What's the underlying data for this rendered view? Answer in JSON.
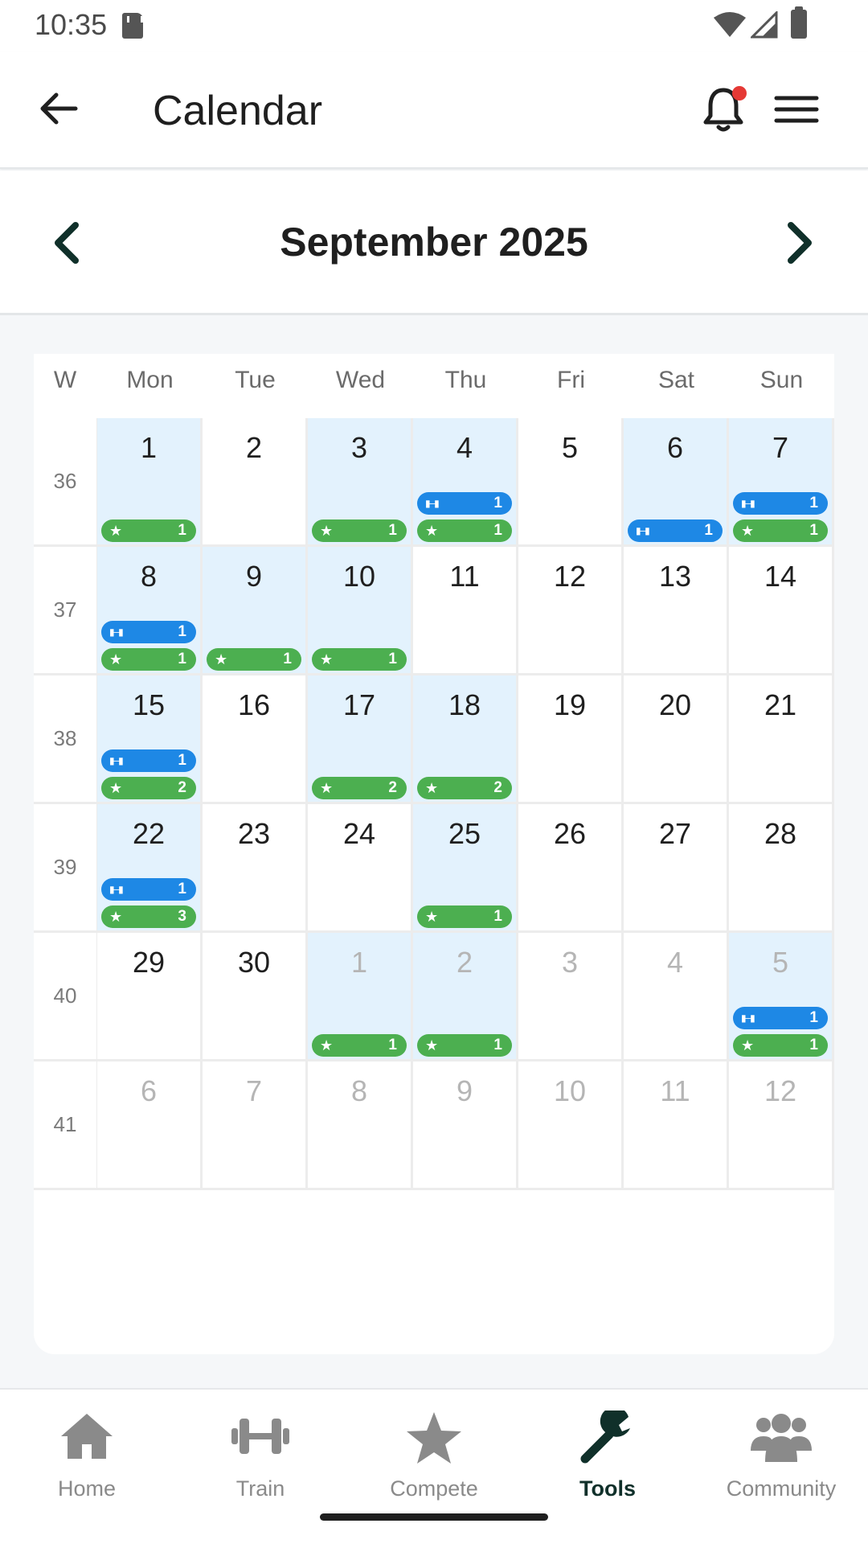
{
  "status_bar": {
    "time": "10:35"
  },
  "app_bar": {
    "title": "Calendar",
    "has_notification": true,
    "notification_dot_color": "#e53935"
  },
  "month_nav": {
    "title": "September 2025"
  },
  "weekdays": {
    "week_header": "W",
    "days": [
      "Mon",
      "Tue",
      "Wed",
      "Thu",
      "Fri",
      "Sat",
      "Sun"
    ]
  },
  "colors": {
    "train_badge": "#1e88e5",
    "compete_badge": "#4caf50",
    "active_day_bg": "#e3f2fd",
    "accent": "#10302a"
  },
  "weeks": [
    {
      "week": "36",
      "days": [
        {
          "day": "1",
          "train": null,
          "compete": "1",
          "other": false
        },
        {
          "day": "2",
          "train": null,
          "compete": null,
          "other": false
        },
        {
          "day": "3",
          "train": null,
          "compete": "1",
          "other": false
        },
        {
          "day": "4",
          "train": "1",
          "compete": "1",
          "other": false
        },
        {
          "day": "5",
          "train": null,
          "compete": null,
          "other": false
        },
        {
          "day": "6",
          "train": "1",
          "compete": null,
          "other": false
        },
        {
          "day": "7",
          "train": "1",
          "compete": "1",
          "other": false
        }
      ]
    },
    {
      "week": "37",
      "days": [
        {
          "day": "8",
          "train": "1",
          "compete": "1",
          "other": false
        },
        {
          "day": "9",
          "train": null,
          "compete": "1",
          "other": false
        },
        {
          "day": "10",
          "train": null,
          "compete": "1",
          "other": false
        },
        {
          "day": "11",
          "train": null,
          "compete": null,
          "other": false
        },
        {
          "day": "12",
          "train": null,
          "compete": null,
          "other": false
        },
        {
          "day": "13",
          "train": null,
          "compete": null,
          "other": false
        },
        {
          "day": "14",
          "train": null,
          "compete": null,
          "other": false
        }
      ]
    },
    {
      "week": "38",
      "days": [
        {
          "day": "15",
          "train": "1",
          "compete": "2",
          "other": false
        },
        {
          "day": "16",
          "train": null,
          "compete": null,
          "other": false
        },
        {
          "day": "17",
          "train": null,
          "compete": "2",
          "other": false
        },
        {
          "day": "18",
          "train": null,
          "compete": "2",
          "other": false
        },
        {
          "day": "19",
          "train": null,
          "compete": null,
          "other": false
        },
        {
          "day": "20",
          "train": null,
          "compete": null,
          "other": false
        },
        {
          "day": "21",
          "train": null,
          "compete": null,
          "other": false
        }
      ]
    },
    {
      "week": "39",
      "days": [
        {
          "day": "22",
          "train": "1",
          "compete": "3",
          "other": false
        },
        {
          "day": "23",
          "train": null,
          "compete": null,
          "other": false
        },
        {
          "day": "24",
          "train": null,
          "compete": null,
          "other": false
        },
        {
          "day": "25",
          "train": null,
          "compete": "1",
          "other": false
        },
        {
          "day": "26",
          "train": null,
          "compete": null,
          "other": false
        },
        {
          "day": "27",
          "train": null,
          "compete": null,
          "other": false
        },
        {
          "day": "28",
          "train": null,
          "compete": null,
          "other": false
        }
      ]
    },
    {
      "week": "40",
      "days": [
        {
          "day": "29",
          "train": null,
          "compete": null,
          "other": false
        },
        {
          "day": "30",
          "train": null,
          "compete": null,
          "other": false
        },
        {
          "day": "1",
          "train": null,
          "compete": "1",
          "other": true
        },
        {
          "day": "2",
          "train": null,
          "compete": "1",
          "other": true
        },
        {
          "day": "3",
          "train": null,
          "compete": null,
          "other": true
        },
        {
          "day": "4",
          "train": null,
          "compete": null,
          "other": true
        },
        {
          "day": "5",
          "train": "1",
          "compete": "1",
          "other": true
        }
      ]
    },
    {
      "week": "41",
      "days": [
        {
          "day": "6",
          "train": null,
          "compete": null,
          "other": true
        },
        {
          "day": "7",
          "train": null,
          "compete": null,
          "other": true
        },
        {
          "day": "8",
          "train": null,
          "compete": null,
          "other": true
        },
        {
          "day": "9",
          "train": null,
          "compete": null,
          "other": true
        },
        {
          "day": "10",
          "train": null,
          "compete": null,
          "other": true
        },
        {
          "day": "11",
          "train": null,
          "compete": null,
          "other": true
        },
        {
          "day": "12",
          "train": null,
          "compete": null,
          "other": true
        }
      ]
    }
  ],
  "bottom_nav": {
    "items": [
      {
        "label": "Home",
        "icon": "home-icon",
        "active": false
      },
      {
        "label": "Train",
        "icon": "dumbbell-icon",
        "active": false
      },
      {
        "label": "Compete",
        "icon": "star-icon",
        "active": false
      },
      {
        "label": "Tools",
        "icon": "wrench-icon",
        "active": true
      },
      {
        "label": "Community",
        "icon": "people-icon",
        "active": false
      }
    ]
  }
}
